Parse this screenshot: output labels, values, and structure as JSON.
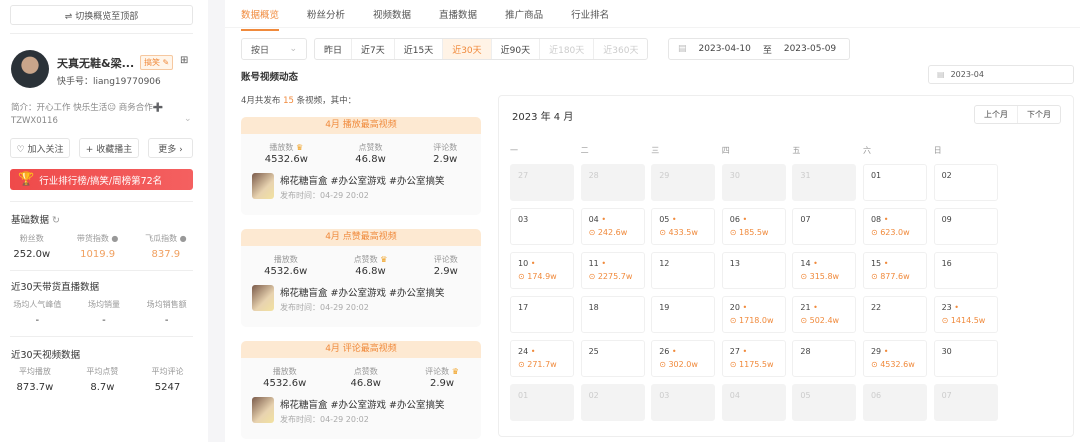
{
  "left": {
    "switch_top": "⇌ 切换概览至顶部",
    "name": "天真无鞋&梁...",
    "tag": "搞笑 ✎",
    "kuaishou_id": "快手号：liang19770906",
    "bio": "简介：开心工作 快乐生活😐 商务合作➕",
    "bio2": "TZWX0116",
    "follow": "♡ 加入关注",
    "collect": "+ 收藏播主",
    "more": "更多 ›",
    "rank_banner": "行业排行榜/搞笑/周榜第72名",
    "basic_title": "基础数据",
    "basic": [
      {
        "label": "粉丝数",
        "value": "252.0w"
      },
      {
        "label": "带货指数",
        "value": "1019.9"
      },
      {
        "label": "飞瓜指数",
        "value": "837.9"
      }
    ],
    "live_title": "近30天带货直播数据",
    "live": [
      {
        "label": "场均人气峰值",
        "value": "-"
      },
      {
        "label": "场均销量",
        "value": "-"
      },
      {
        "label": "场均销售额",
        "value": "-"
      }
    ],
    "video_title": "近30天视频数据",
    "video": [
      {
        "label": "平均播放",
        "value": "873.7w"
      },
      {
        "label": "平均点赞",
        "value": "8.7w"
      },
      {
        "label": "平均评论",
        "value": "5247"
      }
    ]
  },
  "tabs": [
    "数据概览",
    "粉丝分析",
    "视频数据",
    "直播数据",
    "推广商品",
    "行业排名"
  ],
  "filter": {
    "granularity": "按日",
    "ranges": [
      "昨日",
      "近7天",
      "近15天",
      "近30天",
      "近90天",
      "近180天",
      "近360天"
    ],
    "active": "近30天",
    "start": "2023-04-10",
    "to": "至",
    "end": "2023-05-09"
  },
  "section_title": "账号视频动态",
  "month_picker": "2023-04",
  "summary": {
    "pre": "4月共发布 ",
    "count": "15",
    "post": " 条视频，其中："
  },
  "cards": [
    {
      "title": "4月 播放最高视频",
      "stats": [
        {
          "label": "播放数",
          "value": "4532.6w",
          "crown": true
        },
        {
          "label": "点赞数",
          "value": "46.8w"
        },
        {
          "label": "评论数",
          "value": "2.9w"
        }
      ],
      "video": "棉花糖盲盒 #办公室游戏 #办公室搞笑",
      "date": "发布时间：04-29 20:02"
    },
    {
      "title": "4月 点赞最高视频",
      "stats": [
        {
          "label": "播放数",
          "value": "4532.6w"
        },
        {
          "label": "点赞数",
          "value": "46.8w",
          "crown": true
        },
        {
          "label": "评论数",
          "value": "2.9w"
        }
      ],
      "video": "棉花糖盲盒 #办公室游戏 #办公室搞笑",
      "date": "发布时间：04-29 20:02"
    },
    {
      "title": "4月 评论最高视频",
      "stats": [
        {
          "label": "播放数",
          "value": "4532.6w"
        },
        {
          "label": "点赞数",
          "value": "46.8w"
        },
        {
          "label": "评论数",
          "value": "2.9w",
          "crown": true
        }
      ],
      "video": "棉花糖盲盒 #办公室游戏 #办公室搞笑",
      "date": "发布时间：04-29 20:02"
    }
  ],
  "calendar": {
    "title": "2023 年 4 月",
    "prev": "上个月",
    "next": "下个月",
    "weekdays": [
      "一",
      "二",
      "三",
      "四",
      "五",
      "六",
      "日"
    ],
    "days": [
      {
        "d": "27",
        "out": true
      },
      {
        "d": "28",
        "out": true
      },
      {
        "d": "29",
        "out": true
      },
      {
        "d": "30",
        "out": true
      },
      {
        "d": "31",
        "out": true
      },
      {
        "d": "01"
      },
      {
        "d": "02"
      },
      {
        "d": "03"
      },
      {
        "d": "04",
        "plays": "242.6w"
      },
      {
        "d": "05",
        "plays": "433.5w"
      },
      {
        "d": "06",
        "plays": "185.5w"
      },
      {
        "d": "07"
      },
      {
        "d": "08",
        "plays": "623.0w"
      },
      {
        "d": "09"
      },
      {
        "d": "10",
        "plays": "174.9w"
      },
      {
        "d": "11",
        "plays": "2275.7w"
      },
      {
        "d": "12"
      },
      {
        "d": "13"
      },
      {
        "d": "14",
        "plays": "315.8w"
      },
      {
        "d": "15",
        "plays": "877.6w"
      },
      {
        "d": "16"
      },
      {
        "d": "17"
      },
      {
        "d": "18"
      },
      {
        "d": "19"
      },
      {
        "d": "20",
        "plays": "1718.0w"
      },
      {
        "d": "21",
        "plays": "502.4w"
      },
      {
        "d": "22"
      },
      {
        "d": "23",
        "plays": "1414.5w"
      },
      {
        "d": "24",
        "plays": "271.7w"
      },
      {
        "d": "25"
      },
      {
        "d": "26",
        "plays": "302.0w"
      },
      {
        "d": "27",
        "plays": "1175.5w"
      },
      {
        "d": "28"
      },
      {
        "d": "29",
        "plays": "4532.6w"
      },
      {
        "d": "30"
      },
      {
        "d": "01",
        "out": true
      },
      {
        "d": "02",
        "out": true
      },
      {
        "d": "03",
        "out": true
      },
      {
        "d": "04",
        "out": true
      },
      {
        "d": "05",
        "out": true
      },
      {
        "d": "06",
        "out": true
      },
      {
        "d": "07",
        "out": true
      }
    ]
  },
  "colors": {
    "accent": "#f08a3c",
    "banner": "#ef4a4a"
  }
}
